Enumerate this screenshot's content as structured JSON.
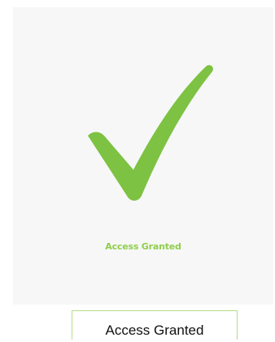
{
  "status": {
    "caption": "Access Granted",
    "icon": "checkmark-icon",
    "accent_color": "#7dc242",
    "caption_color": "#8fce4a"
  },
  "banner": {
    "label": "Access Granted",
    "border_color": "#b7dc86"
  }
}
